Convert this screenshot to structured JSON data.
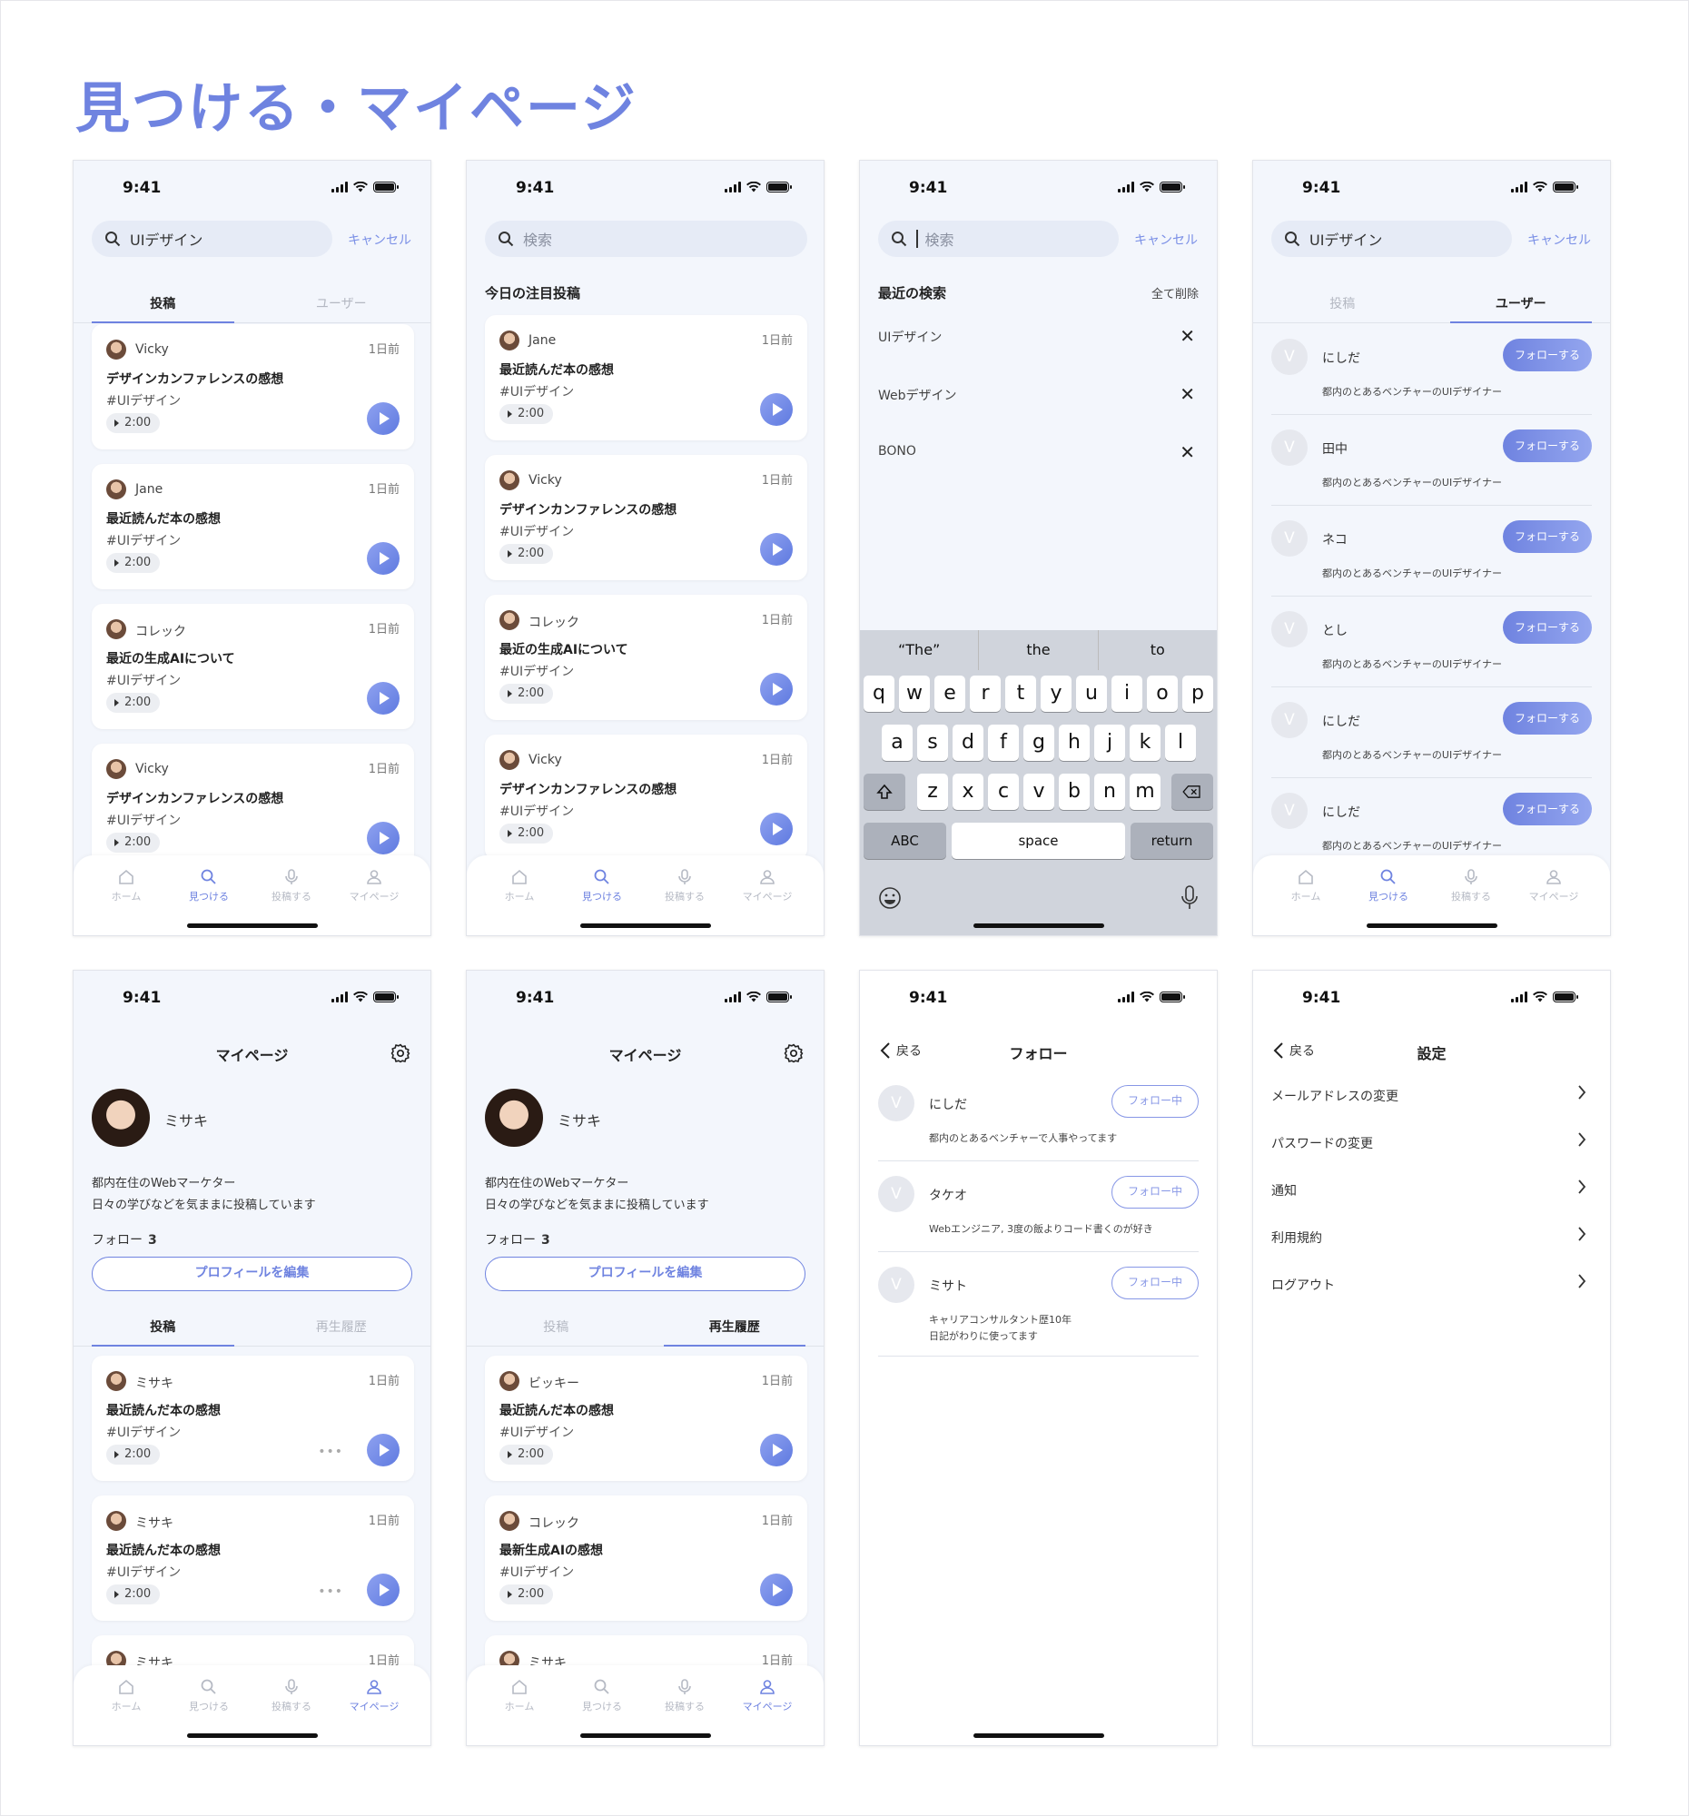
{
  "page_title": "見つける・マイページ",
  "status": {
    "time": "9:41"
  },
  "common": {
    "cancel": "キャンセル",
    "tabbar": {
      "home": "ホーム",
      "discover": "見つける",
      "post": "投稿する",
      "mypage": "マイページ"
    },
    "tab_posts": "投稿",
    "tab_users": "ユーザー",
    "tab_history": "再生履歴",
    "ago": "1日前",
    "tag": "#UIデザイン",
    "duration": "2:00",
    "back": "戻る",
    "follow": "フォローする",
    "following": "フォロー中"
  },
  "screen1": {
    "search_value": "UIデザイン",
    "cards": [
      {
        "user": "Vicky",
        "title": "デザインカンファレンスの感想"
      },
      {
        "user": "Jane",
        "title": "最近読んだ本の感想"
      },
      {
        "user": "コレック",
        "title": "最近の生成AIについて"
      },
      {
        "user": "Vicky",
        "title": "デザインカンファレンスの感想"
      }
    ]
  },
  "screen2": {
    "search_placeholder": "検索",
    "section_title": "今日の注目投稿",
    "cards": [
      {
        "user": "Jane",
        "title": "最近読んだ本の感想"
      },
      {
        "user": "Vicky",
        "title": "デザインカンファレンスの感想"
      },
      {
        "user": "コレック",
        "title": "最近の生成AIについて"
      },
      {
        "user": "Vicky",
        "title": "デザインカンファレンスの感想"
      }
    ]
  },
  "screen3": {
    "search_placeholder": "検索",
    "section_title": "最近の検索",
    "clear_all": "全て削除",
    "recent": [
      "UIデザイン",
      "Webデザイン",
      "BONO"
    ],
    "keyboard": {
      "suggestions": [
        "“The”",
        "the",
        "to"
      ],
      "row1": [
        "q",
        "w",
        "e",
        "r",
        "t",
        "y",
        "u",
        "i",
        "o",
        "p"
      ],
      "row2": [
        "a",
        "s",
        "d",
        "f",
        "g",
        "h",
        "j",
        "k",
        "l"
      ],
      "row3": [
        "z",
        "x",
        "c",
        "v",
        "b",
        "n",
        "m"
      ],
      "abc": "ABC",
      "space": "space",
      "return": "return"
    }
  },
  "screen4": {
    "search_value": "UIデザイン",
    "users": [
      {
        "name": "にしだ",
        "desc": "都内のとあるベンチャーのUIデザイナー"
      },
      {
        "name": "田中",
        "desc": "都内のとあるベンチャーのUIデザイナー"
      },
      {
        "name": "ネコ",
        "desc": "都内のとあるベンチャーのUIデザイナー"
      },
      {
        "name": "とし",
        "desc": "都内のとあるベンチャーのUIデザイナー"
      },
      {
        "name": "にしだ",
        "desc": "都内のとあるベンチャーのUIデザイナー"
      },
      {
        "name": "にしだ",
        "desc": "都内のとあるベンチャーのUIデザイナー"
      }
    ],
    "avatar_letter": "V"
  },
  "profile": {
    "title": "マイページ",
    "name": "ミサキ",
    "bio1": "都内在住のWebマーケター",
    "bio2": "日々の学びなどを気ままに投稿しています",
    "follow_label": "フォロー",
    "follow_count": "3",
    "edit": "プロフィールを編集"
  },
  "screen5": {
    "cards": [
      {
        "user": "ミサキ",
        "title": "最近読んだ本の感想"
      },
      {
        "user": "ミサキ",
        "title": "最近読んだ本の感想"
      },
      {
        "user": "ミサキ",
        "title": ""
      }
    ]
  },
  "screen6": {
    "cards": [
      {
        "user": "ビッキー",
        "title": "最近読んだ本の感想"
      },
      {
        "user": "コレック",
        "title": "最新生成AIの感想"
      },
      {
        "user": "ミサキ",
        "title": ""
      }
    ]
  },
  "screen7": {
    "title": "フォロー",
    "users": [
      {
        "name": "にしだ",
        "desc1": "都内のとあるベンチャーで人事やってます",
        "desc2": ""
      },
      {
        "name": "タケオ",
        "desc1": "Webエンジニア, 3度の飯よりコード書くのが好き",
        "desc2": ""
      },
      {
        "name": "ミサト",
        "desc1": "キャリアコンサルタント歴10年",
        "desc2": "日記がわりに使ってます"
      }
    ]
  },
  "screen8": {
    "title": "設定",
    "items": [
      "メールアドレスの変更",
      "パスワードの変更",
      "通知",
      "利用規約",
      "ログアウト"
    ]
  }
}
